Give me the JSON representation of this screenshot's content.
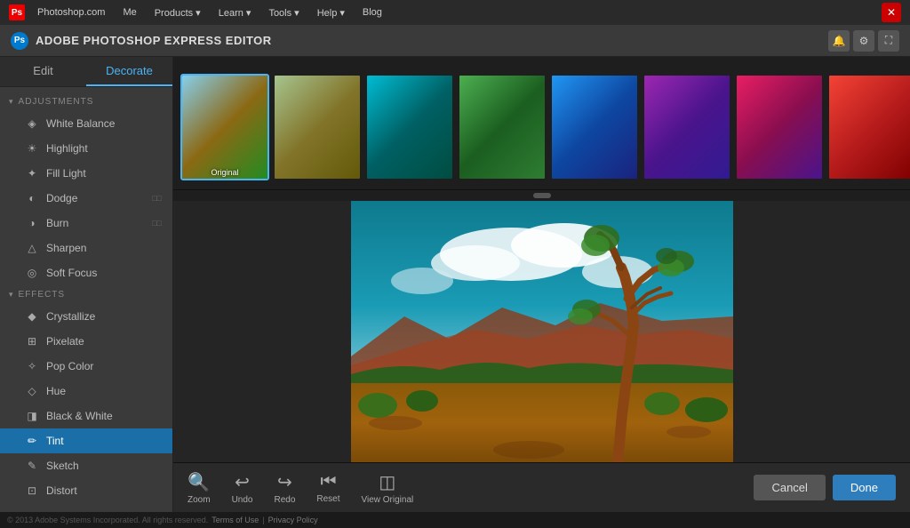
{
  "topnav": {
    "logo_text": "Ps",
    "site_name": "Photoshop.com",
    "links": [
      {
        "label": "Me",
        "id": "nav-me"
      },
      {
        "label": "Products ▾",
        "id": "nav-products"
      },
      {
        "label": "Learn ▾",
        "id": "nav-learn"
      },
      {
        "label": "Tools ▾",
        "id": "nav-tools"
      },
      {
        "label": "Help ▾",
        "id": "nav-help"
      },
      {
        "label": "Blog",
        "id": "nav-blog"
      }
    ],
    "close_label": "✕"
  },
  "editor": {
    "title": "ADOBE PHOTOSHOP EXPRESS EDITOR",
    "logo_text": "Ps",
    "header_icons": [
      "🔔",
      "⚙",
      "⛶"
    ]
  },
  "sidebar": {
    "tabs": [
      {
        "label": "Edit",
        "active": false
      },
      {
        "label": "Decorate",
        "active": true
      }
    ],
    "adjustments_label": "ADJUSTMENTS",
    "effects_label": "EFFECTS",
    "items": [
      {
        "label": "White Balance",
        "icon": "◈",
        "active": false
      },
      {
        "label": "Highlight",
        "icon": "☀",
        "active": false
      },
      {
        "label": "Fill Light",
        "icon": "✦",
        "active": false
      },
      {
        "label": "Dodge",
        "icon": "◐",
        "active": false,
        "badge": "□□"
      },
      {
        "label": "Burn",
        "icon": "◑",
        "active": false,
        "badge": "□□"
      },
      {
        "label": "Sharpen",
        "icon": "△",
        "active": false
      },
      {
        "label": "Soft Focus",
        "icon": "◎",
        "active": false
      },
      {
        "label": "Crystallize",
        "icon": "◆",
        "active": false
      },
      {
        "label": "Pixelate",
        "icon": "⊞",
        "active": false
      },
      {
        "label": "Pop Color",
        "icon": "✧",
        "active": false
      },
      {
        "label": "Hue",
        "icon": "◇",
        "active": false
      },
      {
        "label": "Black & White",
        "icon": "◨",
        "active": false
      },
      {
        "label": "Tint",
        "icon": "✏",
        "active": true
      },
      {
        "label": "Sketch",
        "icon": "✎",
        "active": false
      },
      {
        "label": "Distort",
        "icon": "⊡",
        "active": false
      }
    ]
  },
  "thumbnails": [
    {
      "label": "Original",
      "selected": true,
      "class": "thumb-original"
    },
    {
      "label": "",
      "selected": false,
      "class": "thumb-warm"
    },
    {
      "label": "",
      "selected": false,
      "class": "thumb-teal"
    },
    {
      "label": "",
      "selected": false,
      "class": "thumb-green"
    },
    {
      "label": "",
      "selected": false,
      "class": "thumb-blue"
    },
    {
      "label": "",
      "selected": false,
      "class": "thumb-purple"
    },
    {
      "label": "",
      "selected": false,
      "class": "thumb-magenta"
    },
    {
      "label": "",
      "selected": false,
      "class": "thumb-red"
    }
  ],
  "toolbar": {
    "zoom_label": "Zoom",
    "undo_label": "Undo",
    "redo_label": "Redo",
    "reset_label": "Reset",
    "view_original_label": "View Original",
    "cancel_label": "Cancel",
    "done_label": "Done"
  },
  "footer": {
    "copyright": "© 2013 Adobe Systems Incorporated. All rights reserved.",
    "terms_label": "Terms of Use",
    "privacy_label": "Privacy Policy"
  }
}
